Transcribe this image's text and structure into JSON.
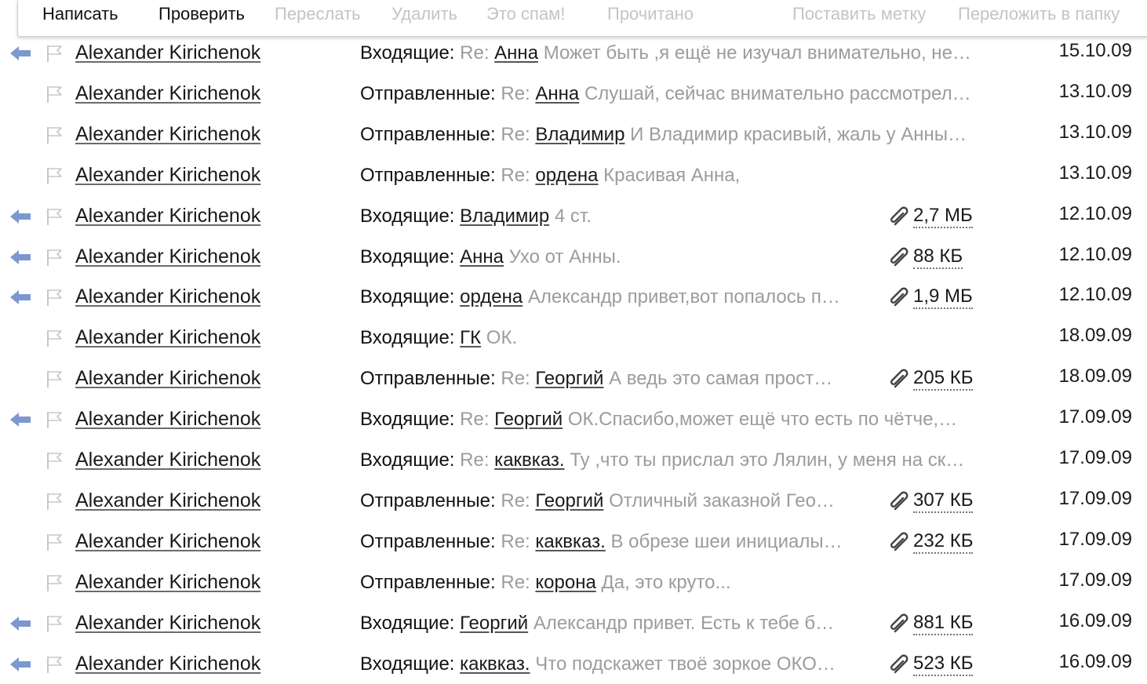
{
  "toolbar": {
    "compose": "Написать",
    "check": "Проверить",
    "forward": "Переслать",
    "delete": "Удалить",
    "spam": "Это спам!",
    "read": "Прочитано",
    "label": "Поставить метку",
    "move": "Переложить в папку"
  },
  "colors": {
    "reply_arrow": "#7d97cf",
    "muted_text": "#9c9c9c",
    "disabled": "#c4c4c4"
  },
  "messages": [
    {
      "replied": true,
      "sender": "Alexander Kirichenok",
      "folder": "Входящие:",
      "re": "Re:",
      "subject": "Анна",
      "snippet": "Может быть ,я ещё не изучал внимательно, не…",
      "attachment": "",
      "date": "15.10.09"
    },
    {
      "replied": false,
      "sender": "Alexander Kirichenok",
      "folder": "Отправленные:",
      "re": "Re:",
      "subject": "Анна",
      "snippet": "Слушай, сейчас внимательно рассмотрел…",
      "attachment": "",
      "date": "13.10.09"
    },
    {
      "replied": false,
      "sender": "Alexander Kirichenok",
      "folder": "Отправленные:",
      "re": "Re:",
      "subject": "Владимир",
      "snippet": "И Владимир красивый, жаль у Анны…",
      "attachment": "",
      "date": "13.10.09"
    },
    {
      "replied": false,
      "sender": "Alexander Kirichenok",
      "folder": "Отправленные:",
      "re": "Re:",
      "subject": "ордена",
      "snippet": "Красивая Анна,",
      "attachment": "",
      "date": "13.10.09"
    },
    {
      "replied": true,
      "sender": "Alexander Kirichenok",
      "folder": "Входящие:",
      "re": "",
      "subject": "Владимир",
      "snippet": "4 ст.",
      "attachment": "2,7 МБ",
      "date": "12.10.09"
    },
    {
      "replied": true,
      "sender": "Alexander Kirichenok",
      "folder": "Входящие:",
      "re": "",
      "subject": "Анна",
      "snippet": "Ухо от Анны.",
      "attachment": "88 КБ",
      "date": "12.10.09"
    },
    {
      "replied": true,
      "sender": "Alexander Kirichenok",
      "folder": "Входящие:",
      "re": "",
      "subject": "ордена",
      "snippet": "Александр привет,вот попалось п…",
      "attachment": "1,9 МБ",
      "date": "12.10.09"
    },
    {
      "replied": false,
      "sender": "Alexander Kirichenok",
      "folder": "Входящие:",
      "re": "",
      "subject": "ГК",
      "snippet": "ОК.",
      "attachment": "",
      "date": "18.09.09"
    },
    {
      "replied": false,
      "sender": "Alexander Kirichenok",
      "folder": "Отправленные:",
      "re": "Re:",
      "subject": "Георгий",
      "snippet": "А ведь это самая прост…",
      "attachment": "205 КБ",
      "date": "18.09.09"
    },
    {
      "replied": true,
      "sender": "Alexander Kirichenok",
      "folder": "Входящие:",
      "re": "Re:",
      "subject": "Георгий",
      "snippet": "ОК.Спасибо,может ещё что есть по чётче,…",
      "attachment": "",
      "date": "17.09.09"
    },
    {
      "replied": false,
      "sender": "Alexander Kirichenok",
      "folder": "Входящие:",
      "re": "Re:",
      "subject": "каквказ.",
      "snippet": "Ту ,что ты прислал это Лялин, у меня на ск…",
      "attachment": "",
      "date": "17.09.09"
    },
    {
      "replied": false,
      "sender": "Alexander Kirichenok",
      "folder": "Отправленные:",
      "re": "Re:",
      "subject": "Георгий",
      "snippet": "Отличный заказной Гео…",
      "attachment": "307 КБ",
      "date": "17.09.09"
    },
    {
      "replied": false,
      "sender": "Alexander Kirichenok",
      "folder": "Отправленные:",
      "re": "Re:",
      "subject": "каквказ.",
      "snippet": "В обрезе шеи инициалы…",
      "attachment": "232 КБ",
      "date": "17.09.09"
    },
    {
      "replied": false,
      "sender": "Alexander Kirichenok",
      "folder": "Отправленные:",
      "re": "Re:",
      "subject": "корона",
      "snippet": "Да, это круто...",
      "attachment": "",
      "date": "17.09.09"
    },
    {
      "replied": true,
      "sender": "Alexander Kirichenok",
      "folder": "Входящие:",
      "re": "",
      "subject": "Георгий",
      "snippet": "Александр привет. Есть к тебе б…",
      "attachment": "881 КБ",
      "date": "16.09.09"
    },
    {
      "replied": true,
      "sender": "Alexander Kirichenok",
      "folder": "Входящие:",
      "re": "",
      "subject": "каквказ.",
      "snippet": "Что подскажет твоё зоркое ОКО…",
      "attachment": "523 КБ",
      "date": "16.09.09"
    }
  ]
}
